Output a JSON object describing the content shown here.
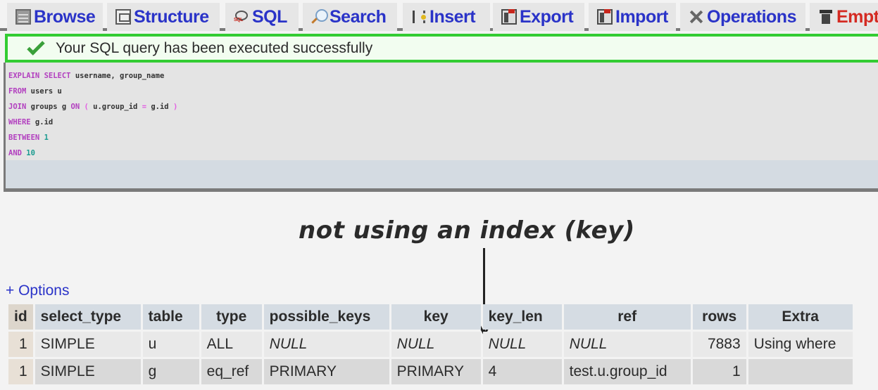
{
  "tabs": [
    {
      "label": "Browse",
      "icon": "browse-icon",
      "danger": false
    },
    {
      "label": "Structure",
      "icon": "structure-icon",
      "danger": false
    },
    {
      "label": "SQL",
      "icon": "sql-icon",
      "danger": false
    },
    {
      "label": "Search",
      "icon": "search-icon",
      "danger": false
    },
    {
      "label": "Insert",
      "icon": "insert-icon",
      "danger": false
    },
    {
      "label": "Export",
      "icon": "export-icon",
      "danger": false
    },
    {
      "label": "Import",
      "icon": "import-icon",
      "danger": false
    },
    {
      "label": "Operations",
      "icon": "operations-icon",
      "danger": false
    },
    {
      "label": "Empty",
      "icon": "empty-icon",
      "danger": true
    }
  ],
  "message": {
    "icon": "checkmark-icon",
    "text": "Your SQL query has been executed successfully"
  },
  "sql": {
    "lines": [
      [
        {
          "t": "EXPLAIN SELECT",
          "c": "kw"
        },
        {
          "t": " username, group_name",
          "c": ""
        }
      ],
      [
        {
          "t": "FROM",
          "c": "kw"
        },
        {
          "t": " users u",
          "c": ""
        }
      ],
      [
        {
          "t": "JOIN",
          "c": "kw"
        },
        {
          "t": " groups g ",
          "c": ""
        },
        {
          "t": "ON",
          "c": "kw"
        },
        {
          "t": " ( ",
          "c": "par"
        },
        {
          "t": "u.group_id ",
          "c": ""
        },
        {
          "t": "=",
          "c": "par"
        },
        {
          "t": " g.id ",
          "c": ""
        },
        {
          "t": ")",
          "c": "par"
        }
      ],
      [
        {
          "t": "WHERE",
          "c": "kw"
        },
        {
          "t": " g.id",
          "c": ""
        }
      ],
      [
        {
          "t": "BETWEEN",
          "c": "kw"
        },
        {
          "t": " 1",
          "c": "num"
        }
      ],
      [
        {
          "t": "AND",
          "c": "kw"
        },
        {
          "t": " 10",
          "c": "num"
        }
      ]
    ]
  },
  "annotation": {
    "text": "not using an index (key)",
    "arrow_icon": "down-arrow-icon"
  },
  "options_link": "+ Options",
  "table": {
    "columns": [
      "id",
      "select_type",
      "table",
      "type",
      "possible_keys",
      "key",
      "key_len",
      "ref",
      "rows",
      "Extra"
    ],
    "rows": [
      [
        "1",
        "SIMPLE",
        "u",
        "ALL",
        "NULL",
        "NULL",
        "NULL",
        "NULL",
        "7883",
        "Using where"
      ],
      [
        "1",
        "SIMPLE",
        "g",
        "eq_ref",
        "PRIMARY",
        "PRIMARY",
        "4",
        "test.u.group_id",
        "1",
        ""
      ]
    ]
  },
  "colors": {
    "tab_link": "#2a33c8",
    "tab_danger": "#d42a22",
    "success_border": "#33cc33",
    "sql_keyword": "#b23fbf",
    "sql_number": "#1a9b8f",
    "header_bg": "#d5dce3"
  }
}
